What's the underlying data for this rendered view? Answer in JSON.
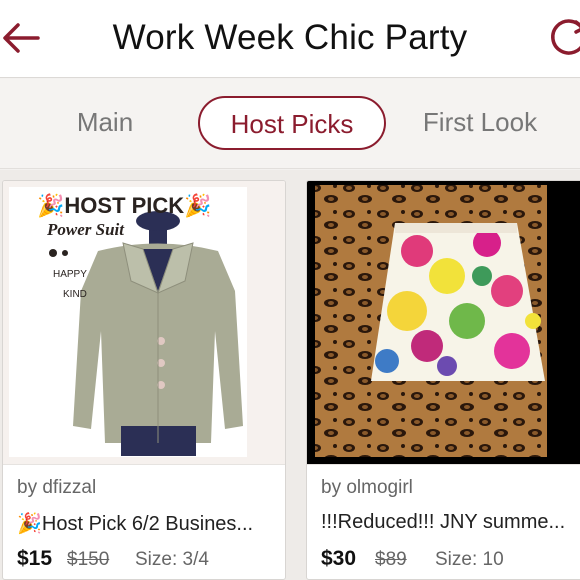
{
  "header": {
    "title": "Work Week Chic Party",
    "back_icon": "back-arrow-icon",
    "refresh_icon": "refresh-icon",
    "accent_color": "#8b1c2e"
  },
  "tabs": [
    {
      "label": "Main",
      "active": false
    },
    {
      "label": "Host Picks",
      "active": true
    },
    {
      "label": "First Look",
      "active": false
    }
  ],
  "listings": [
    {
      "byline": "by dfizzal",
      "title": "🎉Host Pick 6/2 Busines...",
      "price": "$15",
      "original_price": "$150",
      "size": "Size: 3/4",
      "image_overlay": {
        "line1": "🎉HOST PICK🎉",
        "line2": "Power Suit",
        "line3": "HAPPY",
        "line4": "KIND"
      }
    },
    {
      "byline": "by olmogirl",
      "title": "!!!Reduced!!! JNY summe...",
      "price": "$30",
      "original_price": "$89",
      "size": "Size: 10"
    }
  ]
}
